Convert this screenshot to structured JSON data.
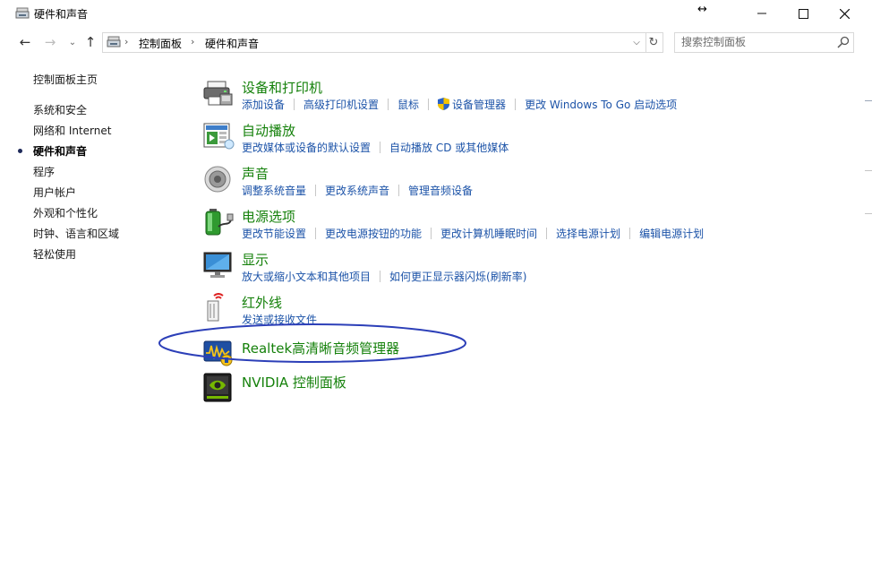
{
  "window": {
    "title": "硬件和声音",
    "icons": {
      "title": "control-panel-icon",
      "minimize": "minimize-icon",
      "maximize": "maximize-icon",
      "close": "close-icon",
      "resize": "resize-cursor-icon"
    }
  },
  "nav": {
    "icons": {
      "back": "back-arrow-icon",
      "forward": "forward-arrow-icon",
      "recent": "chevron-down-icon",
      "up": "up-arrow-icon",
      "refresh": "refresh-icon"
    },
    "breadcrumbs": [
      "控制面板",
      "硬件和声音"
    ],
    "search_placeholder": "搜索控制面板"
  },
  "sidebar": {
    "home": "控制面板主页",
    "items": [
      {
        "label": "系统和安全",
        "active": false
      },
      {
        "label": "网络和 Internet",
        "active": false
      },
      {
        "label": "硬件和声音",
        "active": true
      },
      {
        "label": "程序",
        "active": false
      },
      {
        "label": "用户帐户",
        "active": false
      },
      {
        "label": "外观和个性化",
        "active": false
      },
      {
        "label": "时钟、语言和区域",
        "active": false
      },
      {
        "label": "轻松使用",
        "active": false
      }
    ]
  },
  "categories": [
    {
      "title": "设备和打印机",
      "icon": "printer-icon",
      "links": [
        "添加设备",
        "高级打印机设置",
        "鼠标",
        "设备管理器",
        "更改 Windows To Go 启动选项"
      ]
    },
    {
      "title": "自动播放",
      "icon": "autoplay-icon",
      "links": [
        "更改媒体或设备的默认设置",
        "自动播放 CD 或其他媒体"
      ]
    },
    {
      "title": "声音",
      "icon": "speaker-icon",
      "links": [
        "调整系统音量",
        "更改系统声音",
        "管理音频设备"
      ]
    },
    {
      "title": "电源选项",
      "icon": "battery-icon",
      "links": [
        "更改节能设置",
        "更改电源按钮的功能",
        "更改计算机睡眠时间",
        "选择电源计划",
        "编辑电源计划"
      ]
    },
    {
      "title": "显示",
      "icon": "monitor-icon",
      "links": [
        "放大或缩小文本和其他项目",
        "如何更正显示器闪烁(刷新率)"
      ]
    },
    {
      "title": "红外线",
      "icon": "infrared-icon",
      "links": [
        "发送或接收文件"
      ]
    },
    {
      "title": "Realtek高清晰音频管理器",
      "icon": "realtek-audio-icon",
      "links": []
    },
    {
      "title": "NVIDIA 控制面板",
      "icon": "nvidia-icon",
      "links": []
    }
  ],
  "annotation": {
    "color": "#2c3fb8"
  },
  "colors": {
    "category_title": "#15810b",
    "link": "#1c53a8"
  }
}
